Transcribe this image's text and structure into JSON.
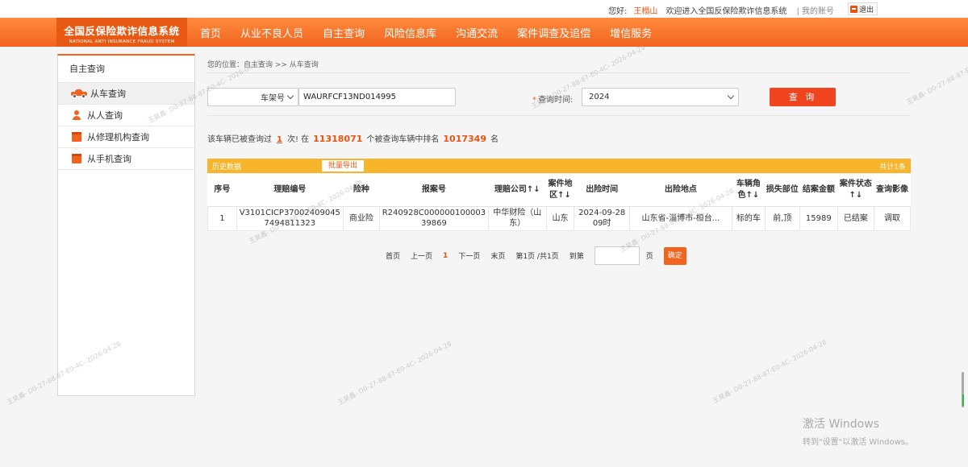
{
  "topbar": {
    "greeting": "您好:",
    "user": "王榻山",
    "welcome": "欢迎进入全国反保险欺诈信息系统",
    "account": "| 我的账号",
    "logout": "退出"
  },
  "logo": {
    "cn": "全国反保险欺诈信息系统",
    "en": "NATIONAL ANTI INSURANCE FRAUD SYSTEM"
  },
  "nav": [
    "首页",
    "从业不良人员",
    "自主查询",
    "风险信息库",
    "沟通交流",
    "案件调查及追偿",
    "增信服务"
  ],
  "sidebar": {
    "title": "自主查询",
    "items": [
      {
        "label": "从车查询",
        "icon": "car-icon"
      },
      {
        "label": "从人查询",
        "icon": "person-icon"
      },
      {
        "label": "从修理机构查询",
        "icon": "repair-shop-icon"
      },
      {
        "label": "从手机查询",
        "icon": "phone-icon"
      }
    ]
  },
  "breadcrumb": "您的位置：自主查询 >> 从车查询",
  "form": {
    "type_value": "车架号",
    "vin_value": "WAURFCF13ND014995",
    "time_required": "*",
    "time_label": "查询时间:",
    "year_value": "2024",
    "search_label": "查 询"
  },
  "stats": {
    "p1": "该车辆已被查询过",
    "count": "1",
    "p2": "次! 在",
    "total": "11318071",
    "p3": "个被查询车辆中排名",
    "rank": "1017349",
    "p4": "名"
  },
  "table": {
    "section_title": "历史数据",
    "export_label": "批量导出",
    "total_label": "共计1条",
    "headers": [
      "序号",
      "理赔编号",
      "险种",
      "报案号",
      "理赔公司↑↓",
      "案件地区↑↓",
      "出险时间",
      "出险地点",
      "车辆角色↑↓",
      "损失部位",
      "结案金额",
      "案件状态↑↓",
      "查询影像"
    ],
    "rows": [
      [
        "1",
        "V3101CICP370024090457494811323",
        "商业险",
        "R240928C00000010000339869",
        "中华财险（山东）",
        "山东",
        "2024-09-28 09时",
        "山东省-淄博市-桓台...",
        "标的车",
        "前,顶",
        "15989",
        "已结案",
        "调取"
      ]
    ]
  },
  "pager": {
    "first": "首页",
    "prev": "上一页",
    "current": "1",
    "next": "下一页",
    "last": "末页",
    "info": "第1页 /共1页",
    "goto": "到第",
    "unit": "页",
    "ok": "确定"
  },
  "watermark": "王昊鑫- D0-27-88-87-E0-4C- 2026-04-28",
  "windows": {
    "line1": "激活 Windows",
    "line2": "转到\"设置\"以激活 Windows。"
  }
}
